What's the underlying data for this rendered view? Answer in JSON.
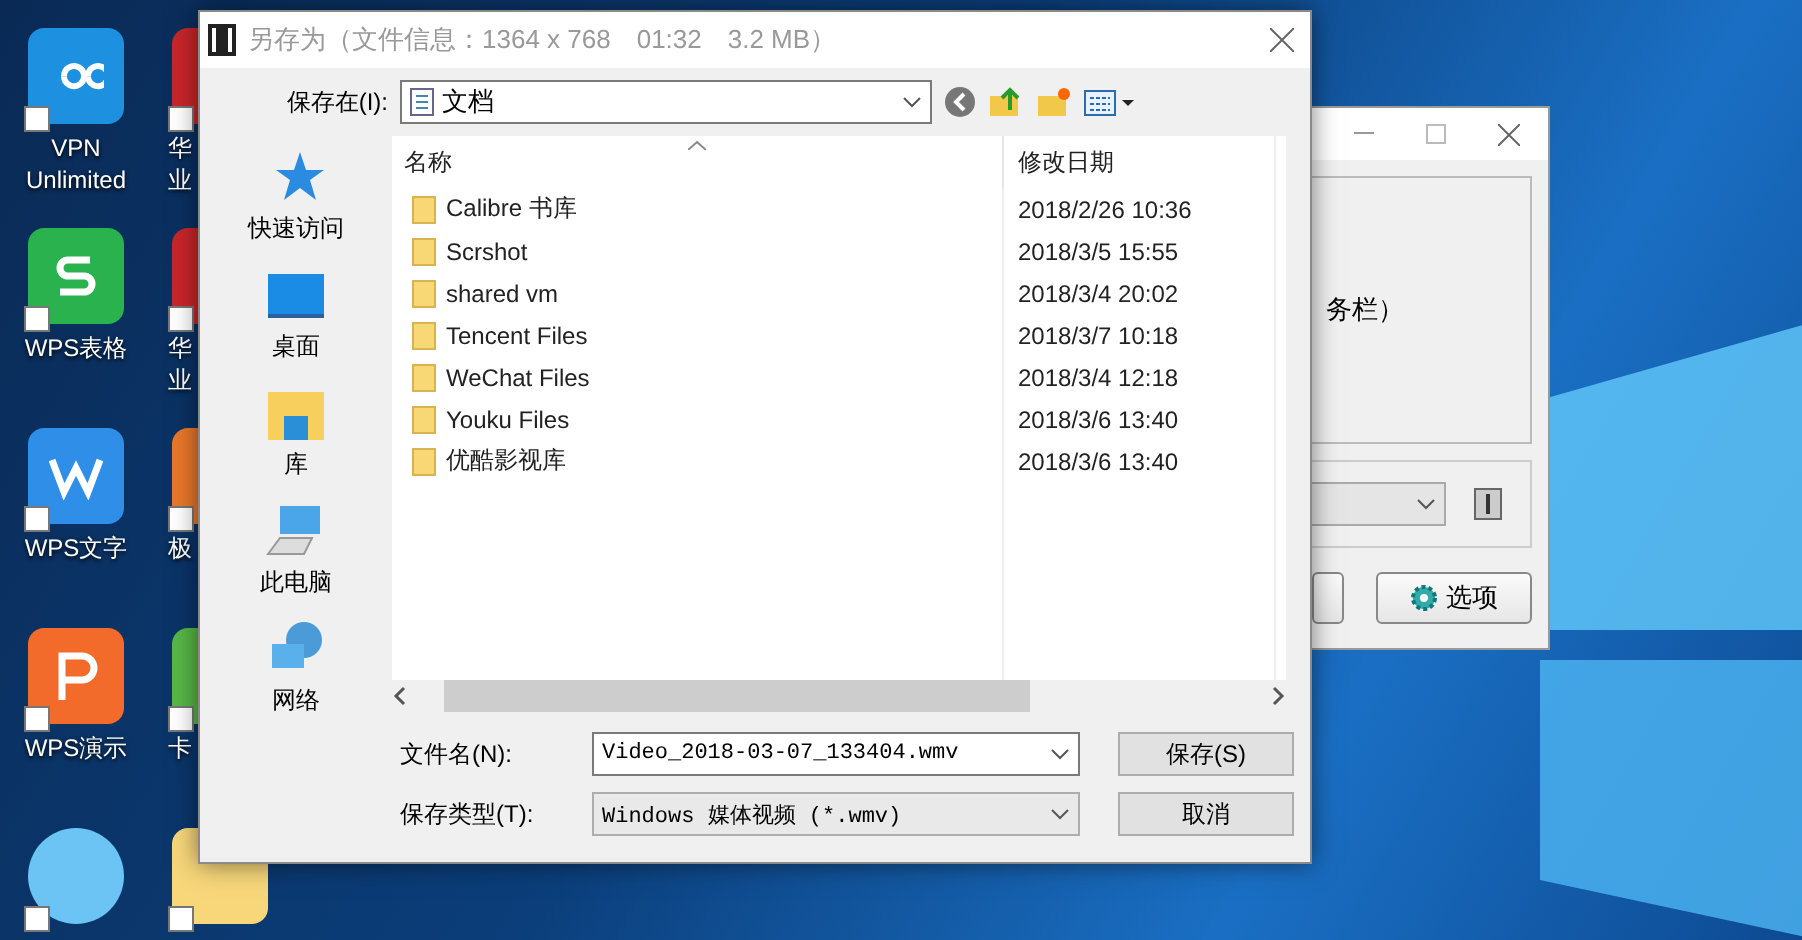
{
  "desktop": {
    "icons": [
      {
        "kind": "vpn",
        "label": "VPN Unlimited"
      },
      {
        "kind": "sheet",
        "label": "WPS表格"
      },
      {
        "kind": "writer",
        "label": "WPS文字"
      },
      {
        "kind": "slides",
        "label": "WPS演示"
      },
      {
        "kind": "chat"
      }
    ],
    "icons_col2": [
      {
        "kind": "red",
        "lines": [
          "华",
          "业"
        ]
      },
      {
        "kind": "red",
        "lines": [
          "华",
          "业"
        ]
      },
      {
        "kind": "orange",
        "lines": [
          "极"
        ]
      },
      {
        "kind": "green",
        "lines": [
          "卡"
        ]
      },
      {
        "kind": "music"
      }
    ]
  },
  "back_window": {
    "text": "务栏）",
    "options_button": "选项"
  },
  "dialog": {
    "title": "另存为（文件信息：1364 x 768　01:32　3.2 MB）",
    "save_in_label": "保存在(I):",
    "location": "文档",
    "places": [
      {
        "kind": "quick",
        "label": "快速访问"
      },
      {
        "kind": "desktop",
        "label": "桌面"
      },
      {
        "kind": "library",
        "label": "库"
      },
      {
        "kind": "pc",
        "label": "此电脑"
      },
      {
        "kind": "network",
        "label": "网络"
      }
    ],
    "columns": [
      "名称",
      "修改日期"
    ],
    "rows": [
      {
        "name": "Calibre 书库",
        "date": "2018/2/26 10:36"
      },
      {
        "name": "Scrshot",
        "date": "2018/3/5 15:55"
      },
      {
        "name": "shared vm",
        "date": "2018/3/4 20:02"
      },
      {
        "name": "Tencent Files",
        "date": "2018/3/7 10:18"
      },
      {
        "name": "WeChat Files",
        "date": "2018/3/4 12:18"
      },
      {
        "name": "Youku Files",
        "date": "2018/3/6 13:40"
      },
      {
        "name": "优酷影视库",
        "date": "2018/3/6 13:40"
      }
    ],
    "filename_label": "文件名(N):",
    "filename": "Video_2018-03-07_133404.wmv",
    "type_label": "保存类型(T):",
    "type": "Windows 媒体视频 (*.wmv)",
    "buttons": [
      {
        "label": "保存(S)"
      },
      {
        "label": "取消"
      }
    ]
  }
}
